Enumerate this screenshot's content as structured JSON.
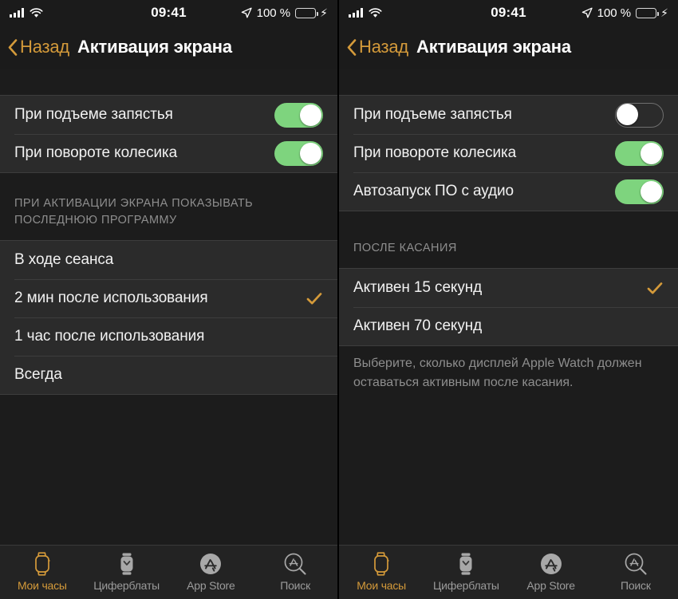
{
  "status_bar": {
    "signal_icon": "cellular-bars-icon",
    "wifi_icon": "wifi-icon",
    "time": "09:41",
    "location_icon": "location-arrow-icon",
    "battery_percent": "100 %",
    "battery_icon": "battery-full-icon",
    "charging_icon": "lightning-bolt-icon",
    "battery_color": "#5cd55c"
  },
  "nav": {
    "back_label": "Назад",
    "back_icon": "chevron-left-icon",
    "title": "Активация экрана",
    "accent_color": "#d49a3a"
  },
  "left_screen": {
    "toggles": [
      {
        "label": "При подъеме запястья",
        "state": "on"
      },
      {
        "label": "При повороте колесика",
        "state": "on"
      }
    ],
    "section_header": "ПРИ АКТИВАЦИИ ЭКРАНА ПОКАЗЫВАТЬ ПОСЛЕДНЮЮ ПРОГРАММУ",
    "options": [
      {
        "label": "В ходе сеанса",
        "selected": false
      },
      {
        "label": "2 мин после использования",
        "selected": true
      },
      {
        "label": "1 час после использования",
        "selected": false
      },
      {
        "label": "Всегда",
        "selected": false
      }
    ]
  },
  "right_screen": {
    "toggles": [
      {
        "label": "При подъеме запястья",
        "state": "off"
      },
      {
        "label": "При повороте колесика",
        "state": "on"
      },
      {
        "label": "Автозапуск ПО с аудио",
        "state": "on"
      }
    ],
    "section_header": "ПОСЛЕ КАСАНИЯ",
    "options": [
      {
        "label": "Активен 15 секунд",
        "selected": true
      },
      {
        "label": "Активен 70 секунд",
        "selected": false
      }
    ],
    "section_footer": "Выберите, сколько дисплей Apple Watch должен оставаться активным после касания."
  },
  "tab_bar": {
    "tabs": [
      {
        "label": "Мои часы",
        "icon": "watch-icon",
        "active": true
      },
      {
        "label": "Циферблаты",
        "icon": "watch-face-icon",
        "active": false
      },
      {
        "label": "App Store",
        "icon": "app-store-icon",
        "active": false
      },
      {
        "label": "Поиск",
        "icon": "search-app-icon",
        "active": false
      }
    ],
    "active_color": "#d49a3a",
    "inactive_color": "#9b9b9b"
  }
}
